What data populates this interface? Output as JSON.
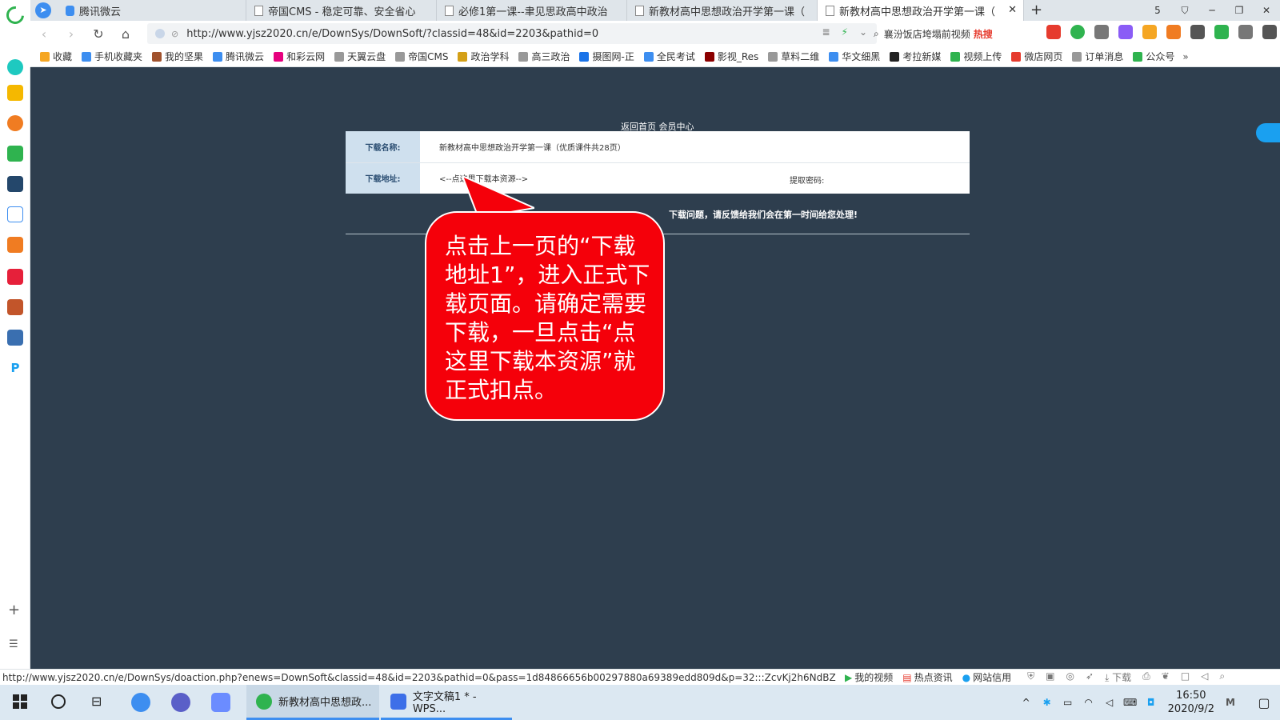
{
  "tabs": [
    {
      "label": "腾讯微云",
      "active": false
    },
    {
      "label": "帝国CMS - 稳定可靠、安全省心",
      "active": false
    },
    {
      "label": "必修1第一课--聿见思政高中政治",
      "active": false
    },
    {
      "label": "新教材高中思想政治开学第一课（",
      "active": false
    },
    {
      "label": "新教材高中思想政治开学第一课（",
      "active": true
    }
  ],
  "tab_counter": "5",
  "address": {
    "url": "http://www.yjsz2020.cn/e/DownSys/DownSoft/?classid=48&id=2203&pathid=0",
    "search_text": "襄汾饭店垮塌前视频",
    "search_hot": "热搜"
  },
  "bookmarks": [
    {
      "label": "收藏",
      "color": "#f5a623"
    },
    {
      "label": "手机收藏夹",
      "color": "#3d8ef0"
    },
    {
      "label": "我的坚果",
      "color": "#a0522d"
    },
    {
      "label": "腾讯微云",
      "color": "#3d8ef0"
    },
    {
      "label": "和彩云网",
      "color": "#e6007e"
    },
    {
      "label": "天翼云盘",
      "color": "#999999"
    },
    {
      "label": "帝国CMS",
      "color": "#999999"
    },
    {
      "label": "政治学科",
      "color": "#d4a017"
    },
    {
      "label": "高三政治",
      "color": "#999999"
    },
    {
      "label": "摄图网-正",
      "color": "#1a73e8"
    },
    {
      "label": "全民考试",
      "color": "#3d8ef0"
    },
    {
      "label": "影视_Res",
      "color": "#8b0000"
    },
    {
      "label": "草料二维",
      "color": "#999999"
    },
    {
      "label": "华文细黑",
      "color": "#3d8ef0"
    },
    {
      "label": "考拉新媒",
      "color": "#222222"
    },
    {
      "label": "视频上传",
      "color": "#2fb34f"
    },
    {
      "label": "微店网页",
      "color": "#e63b2e"
    },
    {
      "label": "订单消息",
      "color": "#999999"
    },
    {
      "label": "公众号",
      "color": "#2fb34f"
    }
  ],
  "bookmarks_more": "»",
  "page": {
    "top_links": "返回首页 会员中心",
    "row1_label": "下载名称:",
    "row1_value": "新教材高中思想政治开学第一课（优质课件共28页）",
    "row2_label": "下载地址:",
    "row2_value": "<--点这里下载本资源-->",
    "code_label": "提取密码:",
    "notice": "下载问题，请反馈给我们会在第一时间给您处理!"
  },
  "callout": {
    "text": "点击上一页的“下载地址1”，进入正式下载页面。请确定需要下载，一旦点击“点这里下载本资源”就正式扣点。",
    "color": "#f5000a"
  },
  "statusbar": {
    "url": "http://www.yjsz2020.cn/e/DownSys/doaction.php?enews=DownSoft&classid=48&id=2203&pathid=0&pass=1d84866656b00297880a69389edd809d&p=32:::ZcvKj2h6NdBZ",
    "items": [
      "我的视频",
      "热点资讯",
      "网站信用"
    ],
    "download": "下载"
  },
  "taskbar": {
    "task1": "新教材高中思想政...",
    "task2": "文字文稿1 * - WPS...",
    "time": "16:50",
    "date": "2020/9/2",
    "ime": "M"
  }
}
